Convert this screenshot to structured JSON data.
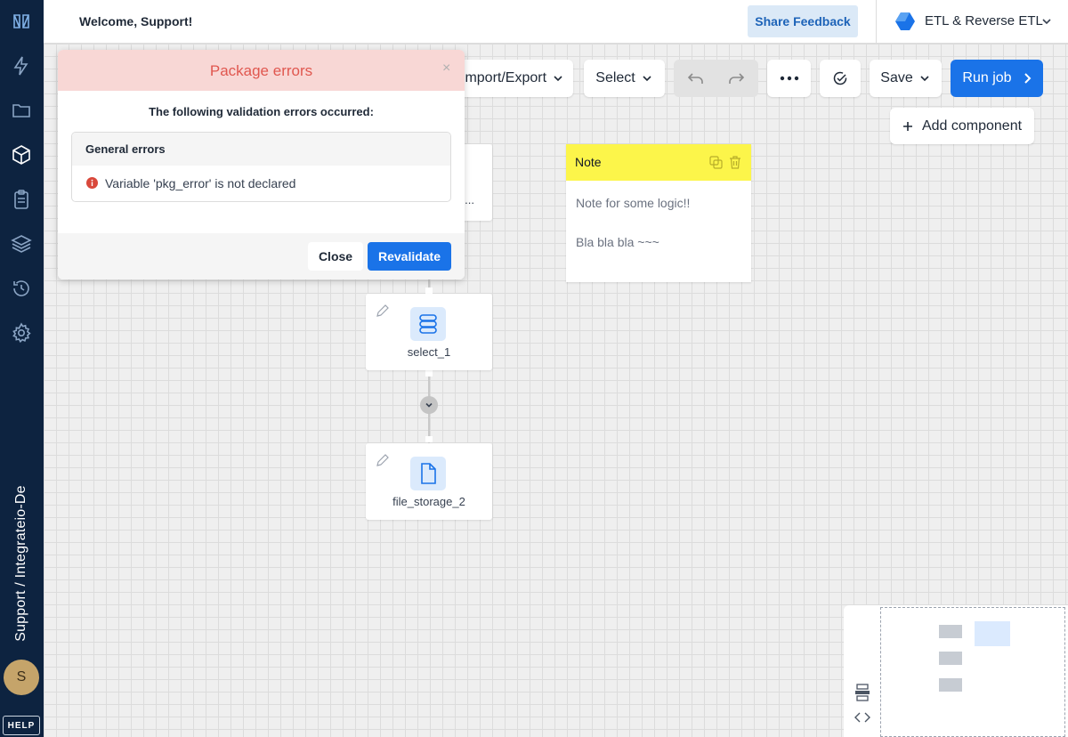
{
  "header": {
    "welcome": "Welcome, Support!",
    "feedback_label": "Share Feedback",
    "product_name": "ETL & Reverse ETL"
  },
  "sidebar": {
    "project_path": "Support / Integrateio-De",
    "avatar_initial": "S",
    "help_label": "HELP",
    "items": [
      "logo-icon",
      "lightning-icon",
      "folder-icon",
      "package-icon",
      "clipboard-icon",
      "layers-icon",
      "history-icon",
      "gear-icon"
    ]
  },
  "toolbar": {
    "import_export_label": "Import/Export",
    "select_label": "Select",
    "save_label": "Save",
    "run_label": "Run job",
    "add_component_label": "Add component"
  },
  "canvas": {
    "nodes": [
      {
        "label": "..."
      },
      {
        "label": "select_1"
      },
      {
        "label": "file_storage_2"
      }
    ],
    "note": {
      "title": "Note",
      "line1": "Note for some logic!!",
      "line2": "Bla bla bla ~~~"
    }
  },
  "modal": {
    "title": "Package errors",
    "close_glyph": "×",
    "message": "The following validation errors occurred:",
    "section_title": "General errors",
    "error_text": "Variable 'pkg_error' is not declared",
    "close_label": "Close",
    "revalidate_label": "Revalidate"
  },
  "colors": {
    "sidebar_bg": "#0d2340",
    "primary": "#1a73e8",
    "error_text": "#e0574f",
    "error_header_bg": "#f8d7d5",
    "note_header": "#fcf54a"
  }
}
